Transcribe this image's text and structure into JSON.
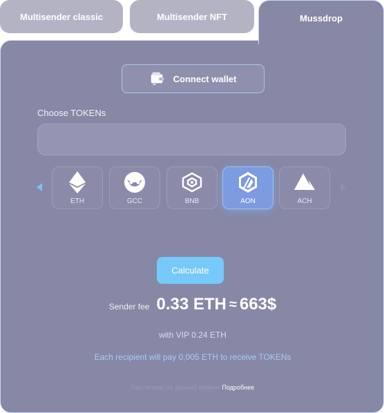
{
  "tabs": [
    {
      "label": "Multisender classic",
      "active": false
    },
    {
      "label": "Multisender NFT",
      "active": false
    },
    {
      "label": "Mussdrop",
      "active": true
    }
  ],
  "connect": {
    "label": "Connect wallet",
    "icon": "wallet-icon"
  },
  "choose": {
    "label": "Choose TOKENs",
    "value": ""
  },
  "tokens": [
    {
      "label": "ETH",
      "icon": "ethereum-icon",
      "selected": false
    },
    {
      "label": "GCC",
      "icon": "owl-icon",
      "selected": false
    },
    {
      "label": "BNB",
      "icon": "bnb-icon",
      "selected": false
    },
    {
      "label": "AON",
      "icon": "arbitrum-icon",
      "selected": true
    },
    {
      "label": "ACH",
      "icon": "ach-icon",
      "selected": false
    }
  ],
  "calculate": {
    "label": "Calculate"
  },
  "fee": {
    "label": "Sender fee",
    "eth": "0.33 ETH",
    "approx": "≈",
    "usd": "663$"
  },
  "vip": "with VIP 0.24 ETH",
  "recipient": "Each recipient will pay 0,005 ETH to receive TOKENs",
  "footnote": {
    "text": "Рассчитано на данный момент",
    "link": "Подробнее"
  },
  "colors": {
    "panel": "#8787a6",
    "accent": "#76c9f8",
    "tab_inactive": "#b3b3c4"
  }
}
